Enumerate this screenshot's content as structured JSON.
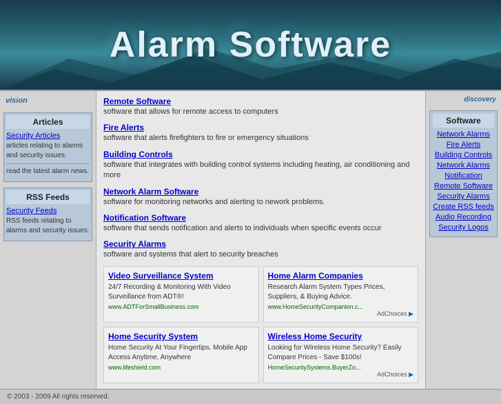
{
  "header": {
    "title": "Alarm Software"
  },
  "left_sidebar": {
    "logo": "vision",
    "articles_box": {
      "title": "Articles",
      "security_link": "Security Articles",
      "security_desc": "articles relating to alarms and security issues.",
      "news_text": "read the latest alarm news."
    },
    "rss_box": {
      "title": "RSS Feeds",
      "feeds_link": "Security Feeds",
      "feeds_desc": "RSS feeds relating to alarms and security issues."
    }
  },
  "center": {
    "items": [
      {
        "link": "Remote Software",
        "desc": "software that allows for remote access to computers"
      },
      {
        "link": "Fire Alerts",
        "desc": "software that alerts firefighters to fire or emergency situations"
      },
      {
        "link": "Building Controls",
        "desc": "software that integrates with building control systems including heating, air conditioning and more"
      },
      {
        "link": "Network Alarm Software",
        "desc": "software for monitoring networks and alerting to nework problems."
      },
      {
        "link": "Notification Software",
        "desc": "software that sends notification and alerts to individuals when specific events occur"
      },
      {
        "link": "Security Alarms",
        "desc": "software and systems that alert to security breaches"
      }
    ],
    "ads": [
      {
        "title": "Video Surveillance System",
        "text": "24/7 Recording & Monitoring With Video Surveillance from ADT®!",
        "url": "www.ADTForSmallBusiness.com",
        "show_adchoices": false
      },
      {
        "title": "Home Alarm Companies",
        "text": "Research Alarm System Types Prices, Suppliers, & Buying Advice.",
        "url": "www.HomeSecurityCompanion.c...",
        "show_adchoices": true
      },
      {
        "title": "Home Security System",
        "text": "Home Security At Your Fingertips. Mobile App Access Anytime, Anywhere",
        "url": "www.lifeshield.com",
        "show_adchoices": false
      },
      {
        "title": "Wireless Home Security",
        "text": "Looking for Wireless Home Security? Easily Compare Prices - Save $100s!",
        "url": "HomeSecuritySystems.BuyerZo...",
        "show_adchoices": true
      }
    ]
  },
  "right_sidebar": {
    "logo": "discovery",
    "software_box": {
      "title": "Software",
      "links": [
        "Network Alarms",
        "Fire Alerts",
        "Building Controls",
        "Network Alarms",
        "Notification",
        "Remote Software",
        "Security Alarms",
        "Create RSS feeds",
        "Audio Recording",
        "Security Logos"
      ]
    }
  },
  "footer": {
    "text": "© 2003 - 2009 All rights reserved."
  }
}
